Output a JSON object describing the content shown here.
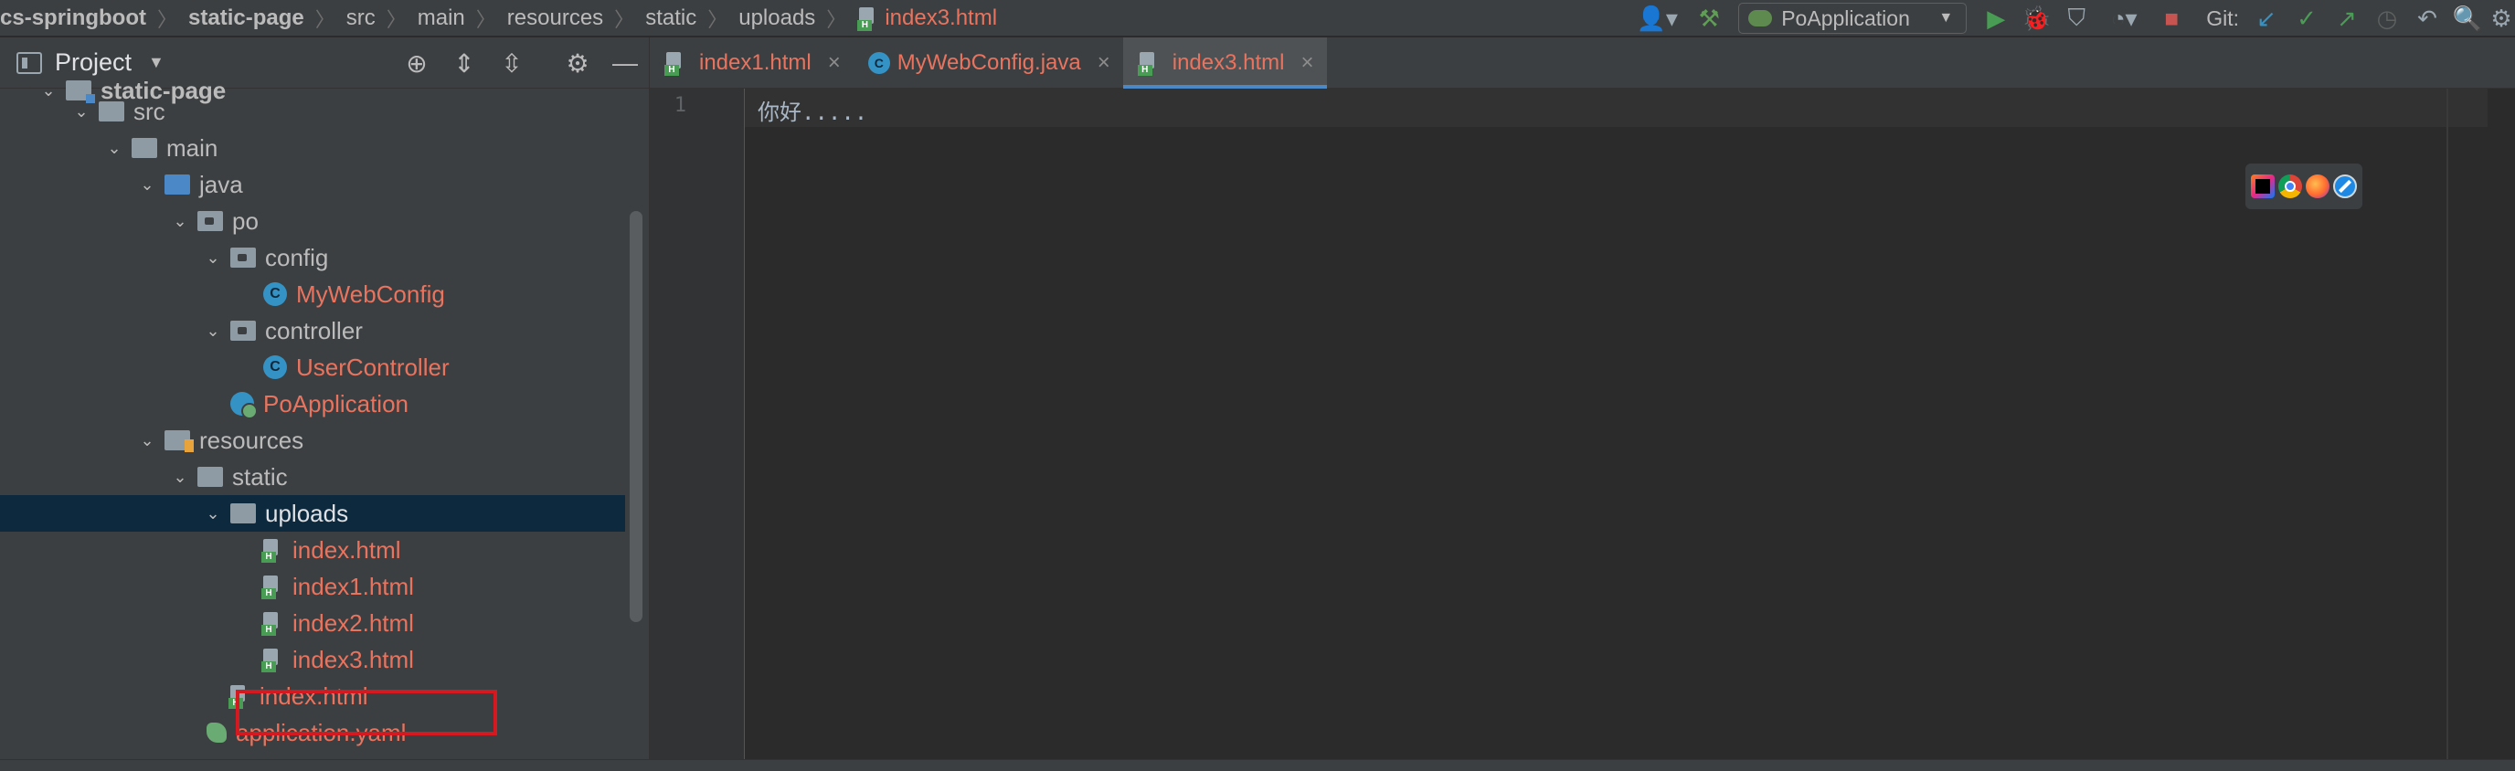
{
  "breadcrumb": {
    "items": [
      "cs-springboot",
      "static-page",
      "src",
      "main",
      "resources",
      "static",
      "uploads"
    ],
    "file": "index3.html"
  },
  "toolbar": {
    "run_config": "PoApplication",
    "git_label": "Git:"
  },
  "project_panel": {
    "title": "Project"
  },
  "tree": {
    "module": "static-page",
    "src": "src",
    "main": "main",
    "java": "java",
    "po": "po",
    "config": "config",
    "my_web_config": "MyWebConfig",
    "controller": "controller",
    "user_controller": "UserController",
    "po_application": "PoApplication",
    "resources": "resources",
    "static": "static",
    "uploads": "uploads",
    "file_index": "index.html",
    "file_index1": "index1.html",
    "file_index2": "index2.html",
    "file_index3": "index3.html",
    "static_index": "index.html",
    "application_yaml": "application.yaml"
  },
  "tabs": [
    {
      "label": "index1.html",
      "active": false
    },
    {
      "label": "MyWebConfig.java",
      "active": false
    },
    {
      "label": "index3.html",
      "active": true
    }
  ],
  "editor": {
    "line_number": "1",
    "content": "你好....."
  },
  "colors": {
    "modified_file": "#e8745f",
    "selection": "#0d293e",
    "highlight_box": "#d41920",
    "active_tab_underline": "#4a88c7"
  }
}
